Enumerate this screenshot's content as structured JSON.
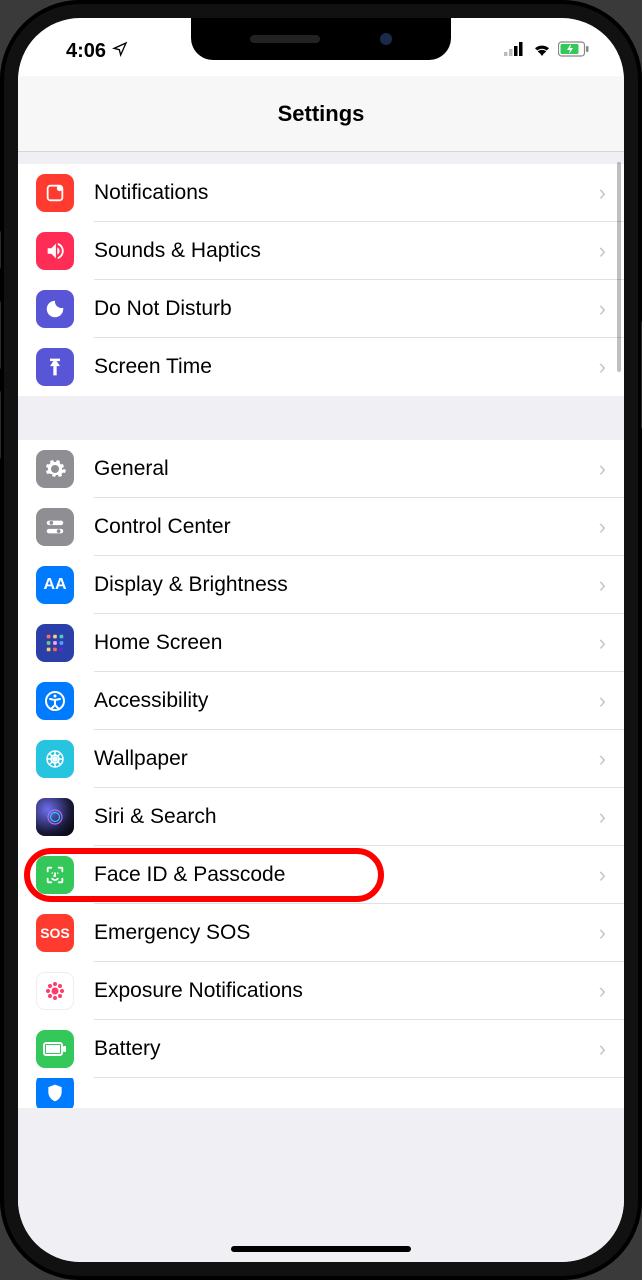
{
  "status": {
    "time": "4:06"
  },
  "header": {
    "title": "Settings"
  },
  "groupA": [
    {
      "label": "Notifications"
    },
    {
      "label": "Sounds & Haptics"
    },
    {
      "label": "Do Not Disturb"
    },
    {
      "label": "Screen Time"
    }
  ],
  "groupB": [
    {
      "label": "General"
    },
    {
      "label": "Control Center"
    },
    {
      "label": "Display & Brightness"
    },
    {
      "label": "Home Screen"
    },
    {
      "label": "Accessibility"
    },
    {
      "label": "Wallpaper"
    },
    {
      "label": "Siri & Search"
    },
    {
      "label": "Face ID & Passcode"
    },
    {
      "label": "Emergency SOS"
    },
    {
      "label": "Exposure Notifications"
    },
    {
      "label": "Battery"
    }
  ],
  "highlighted_row": "face-id-passcode"
}
